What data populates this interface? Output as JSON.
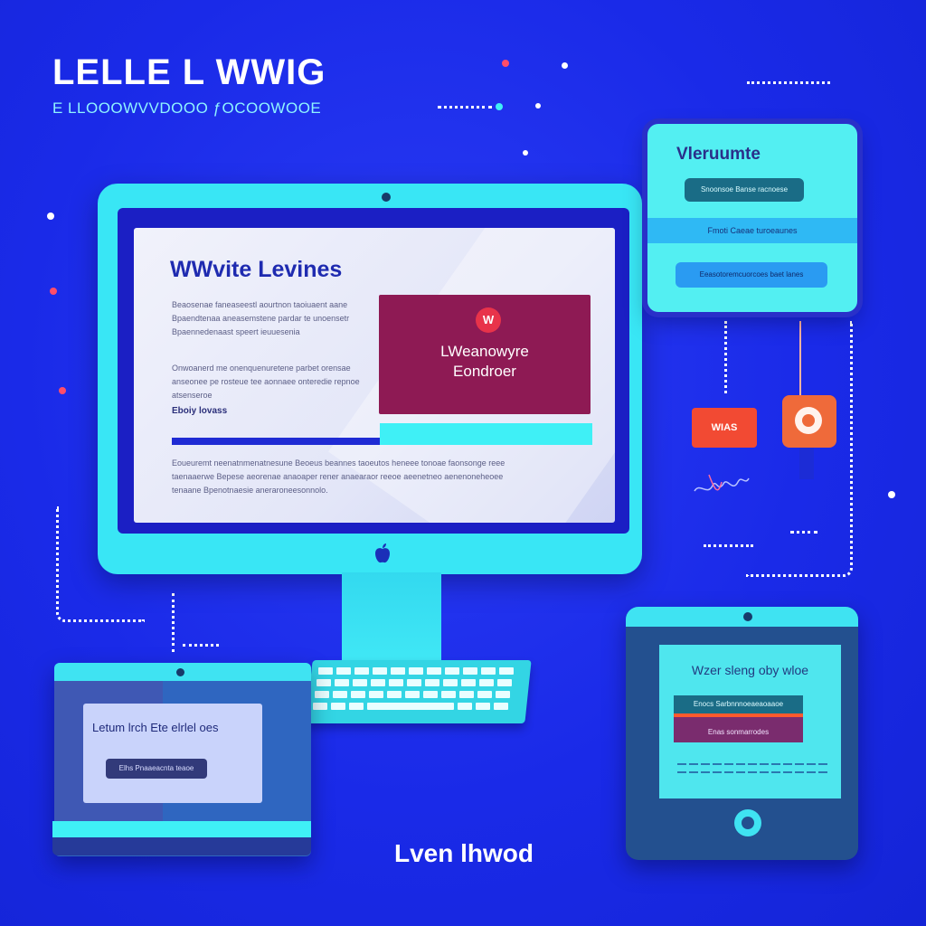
{
  "header": {
    "title": "LELLE L WWIG",
    "subtitle": "E LLOOOWVVDOOO ƒOCOOWOOE"
  },
  "monitor": {
    "screen_title": "WWvite Levines",
    "paragraph_1": "Beaosenae faneaseestl aourtnon taoiuaent aane Bpaendtenaa aneasemstene pardar te unoensetr Bpaennedenaast speert ieuuesenia",
    "paragraph_2": "Onwoanerd me onenquenuretene parbet orensae anseonee pe rosteue tee aonnaee onteredie repnoe atsenseroe",
    "label": "Eboiy lovass",
    "paragraph_3": "Eoueuremt neenatnmenatnesune Beoeus beannes taoeutos heneee tonoae faonsonge reee taenaaerwe Bepese aeorenae anaoaper rener anaearaor reeoe aeenetneo aenenoneheoee tenaane Bpenotnaesie aneraroneesonnolo.",
    "card_badge": "W",
    "card_text_1": "LWeanowyre",
    "card_text_2": "Eondroer"
  },
  "panel_top": {
    "title": "Vleruumte",
    "pill_1": "Snoonsoe Banse racnoese",
    "band": "Fmoti Caeae turoeaunes",
    "pill_2": "Eeasotoremcuorcoes baet lanes"
  },
  "tiles": {
    "red_label": "WIAS"
  },
  "laptop": {
    "card_title": "Letum lrch Ete elrlel oes",
    "pill": "Elhs Pnaaeacnta teaoe"
  },
  "tablet": {
    "title": "Wzer sleng oby wloe",
    "pill_1": "Enocs Sarbnnnoeaeaoaaoe",
    "pill_2": "Enas sonmarrodes"
  },
  "bottom_label": "Lven lhwod",
  "colors": {
    "background": "#1a2ae8",
    "accent_cyan": "#3ff0f6",
    "card_magenta": "#8e1a54",
    "tile_red": "#f24a33",
    "tile_orange": "#ef6a3a"
  },
  "icons": [
    "apple-logo-icon",
    "heart-badge-icon",
    "pin-icon",
    "signature-scribble-icon",
    "home-button-icon"
  ]
}
